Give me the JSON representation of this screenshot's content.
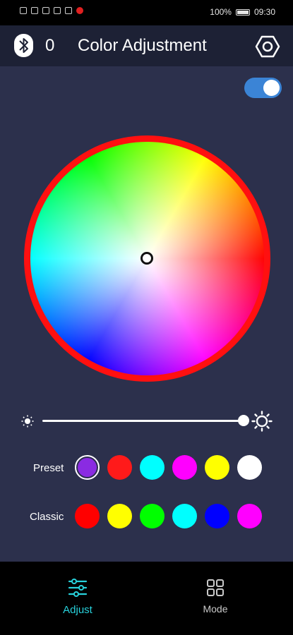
{
  "status_bar": {
    "battery": "100%",
    "time": "09:30"
  },
  "header": {
    "count": "0",
    "title": "Color Adjustment",
    "icons": [
      "bluetooth-icon",
      "settings-icon"
    ]
  },
  "power_toggle": {
    "state": "on",
    "color": "#3b84d6"
  },
  "color_wheel": {
    "ring_color": "#ff1010",
    "selected_position": "center"
  },
  "brightness": {
    "value_fraction": 1.0
  },
  "preset": {
    "label": "Preset",
    "colors": [
      "#8a2be2",
      "#ff1a1a",
      "#00ffff",
      "#ff00ff",
      "#ffff00",
      "#ffffff"
    ],
    "selected_index": 0
  },
  "classic": {
    "label": "Classic",
    "colors": [
      "#ff0000",
      "#ffff00",
      "#00ff00",
      "#00ffff",
      "#0000ff",
      "#ff00ff"
    ]
  },
  "nav": {
    "adjust_label": "Adjust",
    "mode_label": "Mode",
    "active_color": "#28d2dc"
  }
}
